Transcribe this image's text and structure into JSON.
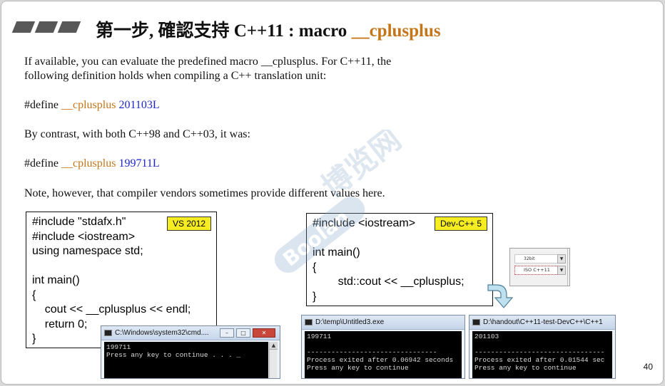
{
  "title": {
    "prefix": "第一步, 確認支持 C++11 :  macro ",
    "highlight": "__cplusplus"
  },
  "paragraph1": {
    "line1": "If available, you can evaluate the predefined macro __cplusplus. For C++11, the",
    "line2": "following definition holds when compiling a C++ translation unit:"
  },
  "define1": {
    "directive": "#define ",
    "macro": "__cplusplus",
    "value": " 201103L"
  },
  "paragraph2": "By contrast, with both C++98 and C++03, it was:",
  "define2": {
    "directive": "#define ",
    "macro": "__cplusplus",
    "value": " 199711L"
  },
  "paragraph3": "Note, however, that compiler vendors sometimes provide different values here.",
  "vs_code": {
    "tag": "VS 2012",
    "lines": [
      "#include \"stdafx.h\"",
      "#include <iostream>",
      "using namespace std;",
      "",
      "int main()",
      "{",
      "    cout << __cplusplus << endl;",
      "    return 0;",
      "}"
    ]
  },
  "dev_code": {
    "tag": "Dev-C++ 5",
    "lines": [
      "#include <iostream>",
      "",
      "int main()",
      "{",
      "        std::cout << __cplusplus;",
      "}"
    ]
  },
  "console_vs": {
    "title": "C:\\Windows\\system32\\cmd....",
    "output": "199711\nPress any key to continue . . . _"
  },
  "console_dev1": {
    "title": "D:\\temp\\Untitled3.exe",
    "output": "199711\n\n--------------------------------\nProcess exited after 0.06942 seconds\nPress any key to continue"
  },
  "console_dev2": {
    "title": "D:\\handout\\C++11-test-DevC++\\C++1",
    "output": "201103\n\n--------------------------------\nProcess exited after 0.01544 sec\nPress any key to continue"
  },
  "settings": {
    "opt1": "32bit",
    "opt2": "ISO C++11"
  },
  "watermark": {
    "main": "博览网",
    "brand": "Boolan"
  },
  "page_number": "40",
  "colors": {
    "accent": "#c5751a",
    "number_blue": "#1d26c9",
    "tag_yellow": "#f6ec22"
  },
  "icons": [
    "console-icon",
    "minimize-icon",
    "maximize-icon",
    "close-icon",
    "down-arrow-icon",
    "scroll-up-icon",
    "scroll-down-icon"
  ]
}
